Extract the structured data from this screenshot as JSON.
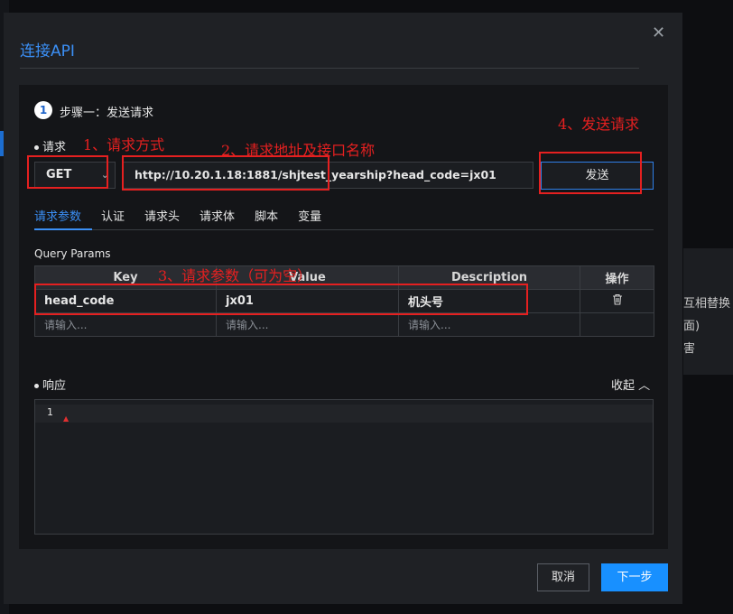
{
  "background": {
    "right_texts": [
      "互相替换",
      "面)",
      "害"
    ]
  },
  "modal": {
    "title": "连接API",
    "close_glyph": "✕"
  },
  "step": {
    "number": "1",
    "label": "步骤一：发送请求"
  },
  "request": {
    "label": "请求",
    "method": "GET",
    "method_chevron": "⌄",
    "url": "http://10.20.1.18:1881/shjtest_yearship?head_code=jx01",
    "send_label": "发送"
  },
  "tabs": [
    "请求参数",
    "认证",
    "请求头",
    "请求体",
    "脚本",
    "变量"
  ],
  "query_params": {
    "title": "Query Params",
    "columns": [
      "Key",
      "Value",
      "Description",
      "操作"
    ],
    "rows": [
      {
        "key": "head_code",
        "value": "jx01",
        "description": "机头号"
      }
    ],
    "placeholder": "请输入..."
  },
  "response": {
    "label": "响应",
    "collapse_label": "收起 ︿",
    "line_number": "1",
    "cursor_glyph": "▲"
  },
  "footer": {
    "cancel_label": "取消",
    "next_label": "下一步"
  },
  "annotations": {
    "a1": "1、请求方式",
    "a2": "2、请求地址及接口名称",
    "a3": "3、请求参数（可为空）",
    "a4": "4、发送请求"
  },
  "colors": {
    "accent": "#3b8ff5",
    "primary_button": "#1890ff",
    "annotation": "#e52020"
  },
  "icons": {
    "delete": "trash-icon",
    "close": "close-icon",
    "dropdown": "chevron-down-icon"
  }
}
